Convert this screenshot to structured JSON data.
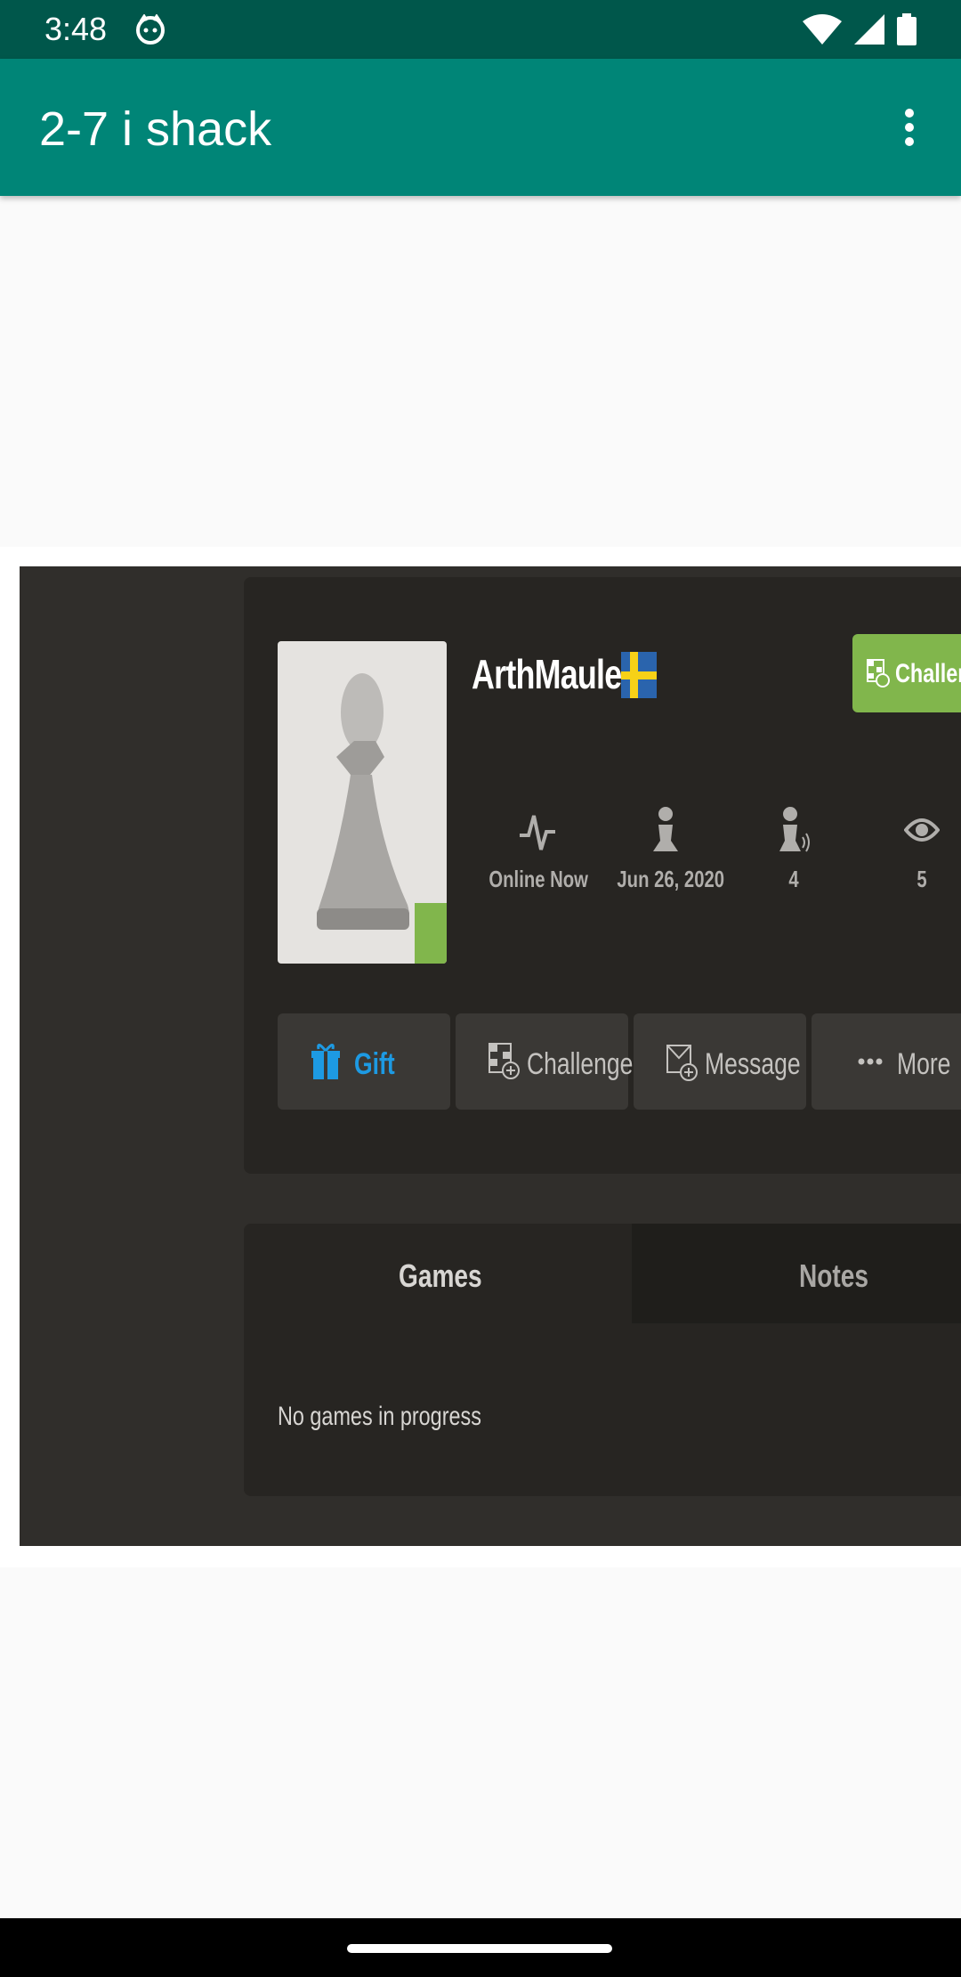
{
  "status_bar": {
    "time": "3:48"
  },
  "app_bar": {
    "title": "2-7 i shack"
  },
  "profile": {
    "username": "ArthMauler",
    "challenge_top_label": "Challeng",
    "stats": [
      {
        "icon": "activity-icon",
        "value": "Online Now"
      },
      {
        "icon": "pawn-icon",
        "value": "Jun 26, 2020"
      },
      {
        "icon": "followers-icon",
        "value": "4"
      },
      {
        "icon": "eye-icon",
        "value": "5"
      }
    ],
    "buttons": {
      "gift": "Gift",
      "challenge": "Challenge",
      "message": "Message",
      "more": "More"
    }
  },
  "games_panel": {
    "tabs": {
      "games": "Games",
      "notes": "Notes"
    },
    "empty_text": "No games in progress"
  },
  "colors": {
    "status_bar": "#00574b",
    "app_bar": "#008577",
    "accent_green": "#81b64c",
    "gift_blue": "#1d9ae3",
    "dark_bg": "#302e2b"
  }
}
